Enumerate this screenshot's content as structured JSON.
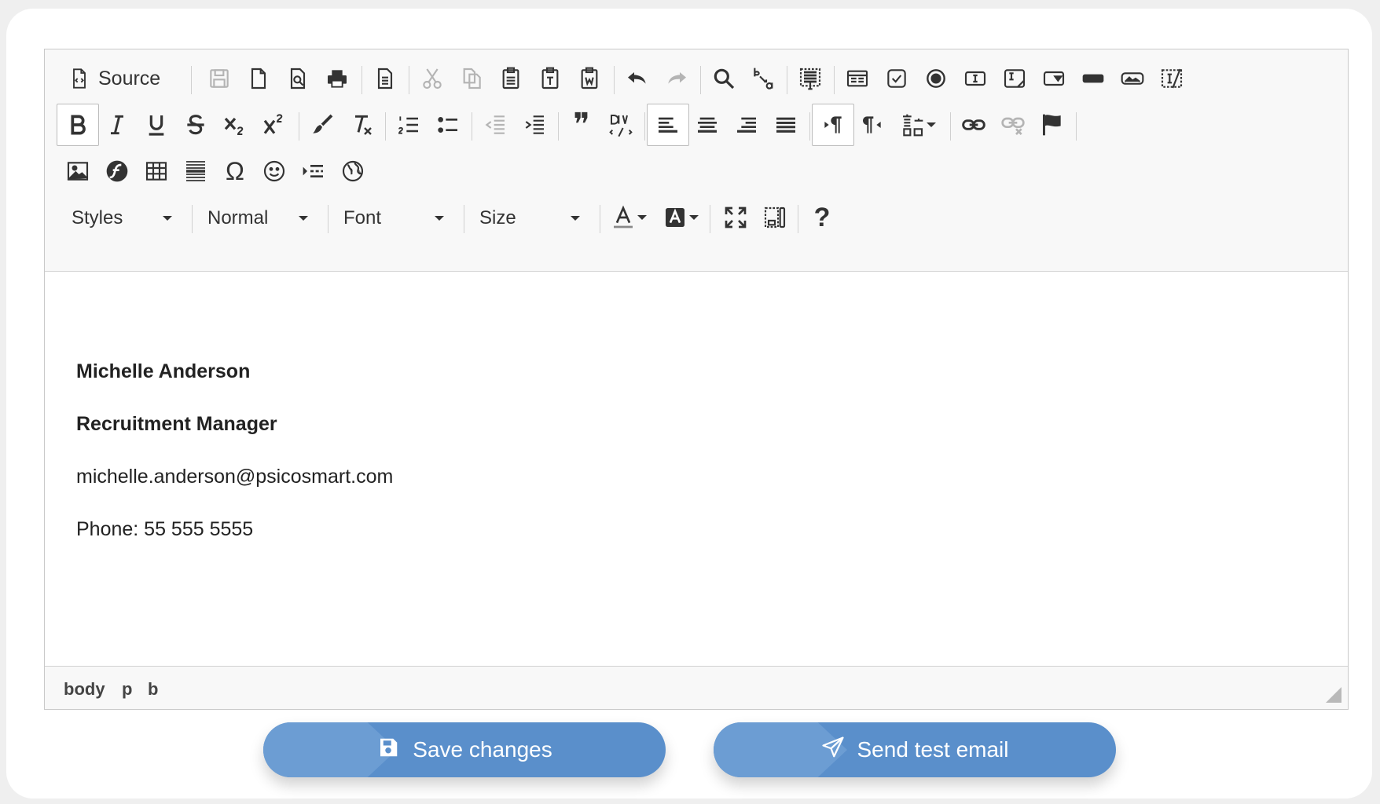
{
  "toolbar": {
    "source_label": "Source",
    "styles_label": "Styles",
    "format_label": "Normal",
    "font_label": "Font",
    "size_label": "Size",
    "help_glyph": "?",
    "omega_glyph": "Ω",
    "quote_glyph": "❞"
  },
  "content": {
    "lines": [
      {
        "text": "Michelle Anderson",
        "bold": true
      },
      {
        "text": "Recruitment Manager",
        "bold": true
      },
      {
        "text": "michelle.anderson@psicosmart.com",
        "bold": false
      },
      {
        "text": "Phone: 55 555 5555",
        "bold": false
      }
    ]
  },
  "pathbar": {
    "items": [
      "body",
      "p",
      "b"
    ]
  },
  "actions": {
    "save_label": "Save changes",
    "send_label": "Send test email"
  },
  "colors": {
    "button_bg": "#5a8fcb",
    "button_shade": "#6c9dd3",
    "toolbar_bg": "#f8f8f8"
  }
}
